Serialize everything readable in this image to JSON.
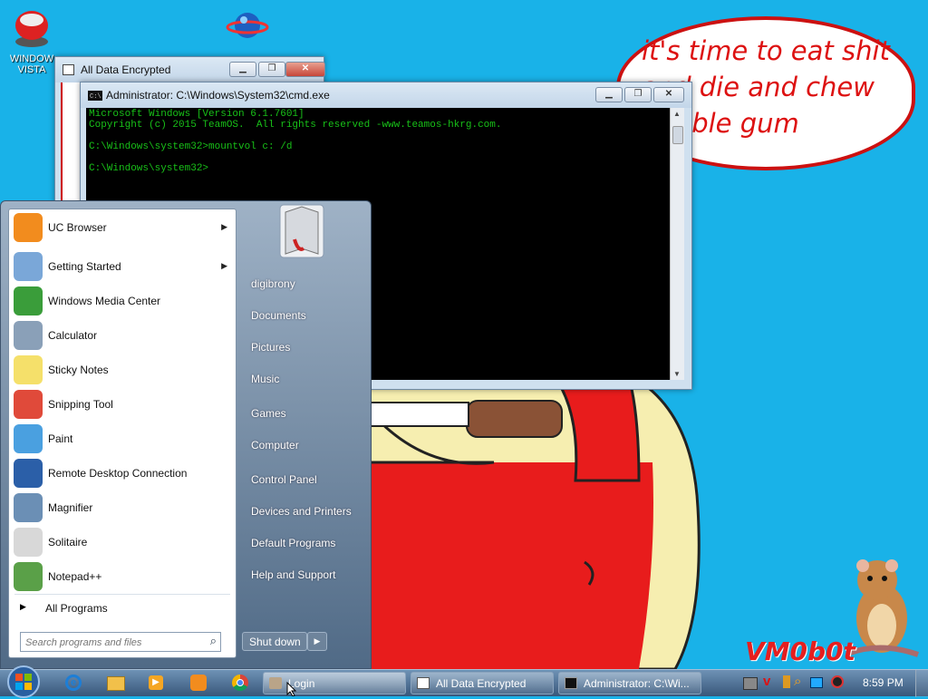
{
  "desktop": {
    "icon_vista_label": "WINDOW\nVISTA",
    "bubble_text": "it's time to eat shit and die and chew bubble gum",
    "watermark": "VM0b0t"
  },
  "win_encrypted": {
    "title": "All Data Encrypted"
  },
  "cmd": {
    "title": "Administrator: C:\\Windows\\System32\\cmd.exe",
    "lines": [
      "Microsoft Windows [Version 6.1.7601]",
      "Copyright (c) 2015 TeamOS.  All rights reserved -www.teamos-hkrg.com.",
      "",
      "C:\\Windows\\system32>mountvol c: /d",
      "",
      "C:\\Windows\\system32>"
    ]
  },
  "start_menu": {
    "programs": [
      {
        "label": "UC Browser",
        "icon": "uc-browser-icon",
        "arrow": true
      },
      {
        "label": "Getting Started",
        "icon": "getting-started-icon",
        "arrow": true
      },
      {
        "label": "Windows Media Center",
        "icon": "media-center-icon",
        "arrow": false
      },
      {
        "label": "Calculator",
        "icon": "calculator-icon",
        "arrow": false
      },
      {
        "label": "Sticky Notes",
        "icon": "sticky-notes-icon",
        "arrow": false
      },
      {
        "label": "Snipping Tool",
        "icon": "snipping-tool-icon",
        "arrow": false
      },
      {
        "label": "Paint",
        "icon": "paint-icon",
        "arrow": false
      },
      {
        "label": "Remote Desktop Connection",
        "icon": "remote-desktop-icon",
        "arrow": false
      },
      {
        "label": "Magnifier",
        "icon": "magnifier-icon",
        "arrow": false
      },
      {
        "label": "Solitaire",
        "icon": "solitaire-icon",
        "arrow": false
      },
      {
        "label": "Notepad++",
        "icon": "notepadpp-icon",
        "arrow": false
      }
    ],
    "all_programs": "All Programs",
    "search_placeholder": "Search programs and files",
    "right_items": [
      "digibrony",
      "Documents",
      "Pictures",
      "Music",
      "Games",
      "Computer",
      "Control Panel",
      "Devices and Printers",
      "Default Programs",
      "Help and Support"
    ],
    "shutdown": "Shut down"
  },
  "taskbar": {
    "tasks": [
      {
        "label": "Login",
        "active": true
      },
      {
        "label": "All Data Encrypted",
        "active": false
      },
      {
        "label": "Administrator: C:\\Wi...",
        "active": false
      }
    ],
    "clock": "8:59 PM"
  },
  "colors": {
    "desktop": "#19b2e8",
    "bubble_text": "#d11111",
    "console_text": "#18c018"
  }
}
